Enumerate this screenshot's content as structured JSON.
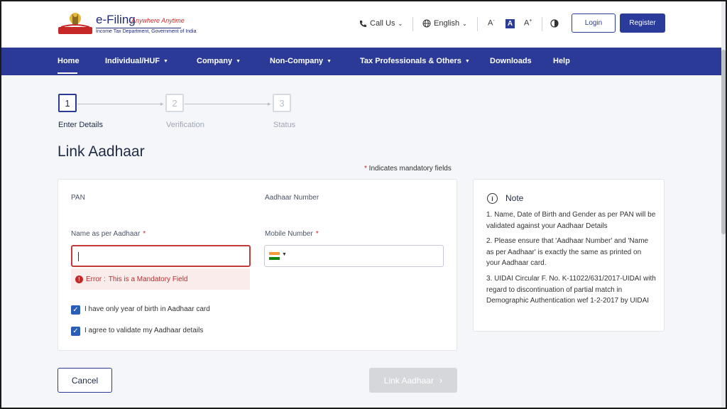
{
  "header": {
    "logo_title": "e-Filing",
    "logo_tagline": "Anywhere Anytime",
    "logo_sub": "Income Tax Department, Government of India",
    "call_us": "Call Us",
    "language": "English",
    "font_decrease": "A",
    "font_normal": "A",
    "font_increase": "A",
    "login": "Login",
    "register": "Register"
  },
  "nav": {
    "items": [
      {
        "label": "Home"
      },
      {
        "label": "Individual/HUF"
      },
      {
        "label": "Company"
      },
      {
        "label": "Non-Company"
      },
      {
        "label": "Tax Professionals & Others"
      },
      {
        "label": "Downloads"
      },
      {
        "label": "Help"
      }
    ]
  },
  "stepper": {
    "steps": [
      {
        "number": "1",
        "label": "Enter Details"
      },
      {
        "number": "2",
        "label": "Verification"
      },
      {
        "number": "3",
        "label": "Status"
      }
    ]
  },
  "page": {
    "title": "Link Aadhaar",
    "mandatory_star": "*",
    "mandatory_note": " Indicates mandatory fields"
  },
  "form": {
    "pan_label": "PAN",
    "aadhaar_label": "Aadhaar Number",
    "name_label": "Name as per Aadhaar",
    "mobile_label": "Mobile Number",
    "required_mark": "*",
    "error_prefix": "Error : ",
    "error_text": "This is a Mandatory Field",
    "checkbox1": "I have only year of birth in Aadhaar card",
    "checkbox2": "I agree to validate my Aadhaar details"
  },
  "note": {
    "title": "Note",
    "items": [
      "1. Name, Date of Birth and Gender as per PAN will be validated against your Aadhaar Details",
      "2. Please ensure that 'Aadhaar Number' and 'Name as per Aadhaar' is exactly the same as printed on your Aadhaar card.",
      "3. UIDAI Circular F. No. K-11022/631/2017-UIDAI with regard to discontinuation of partial match in Demographic Authentication wef 1-2-2017 by UIDAI"
    ]
  },
  "actions": {
    "cancel": "Cancel",
    "link": "Link Aadhaar"
  },
  "colors": {
    "nav_bg": "#2b3a97",
    "error": "#c62828",
    "checkbox": "#2a5db5",
    "disabled_button": "#d5d7db"
  }
}
